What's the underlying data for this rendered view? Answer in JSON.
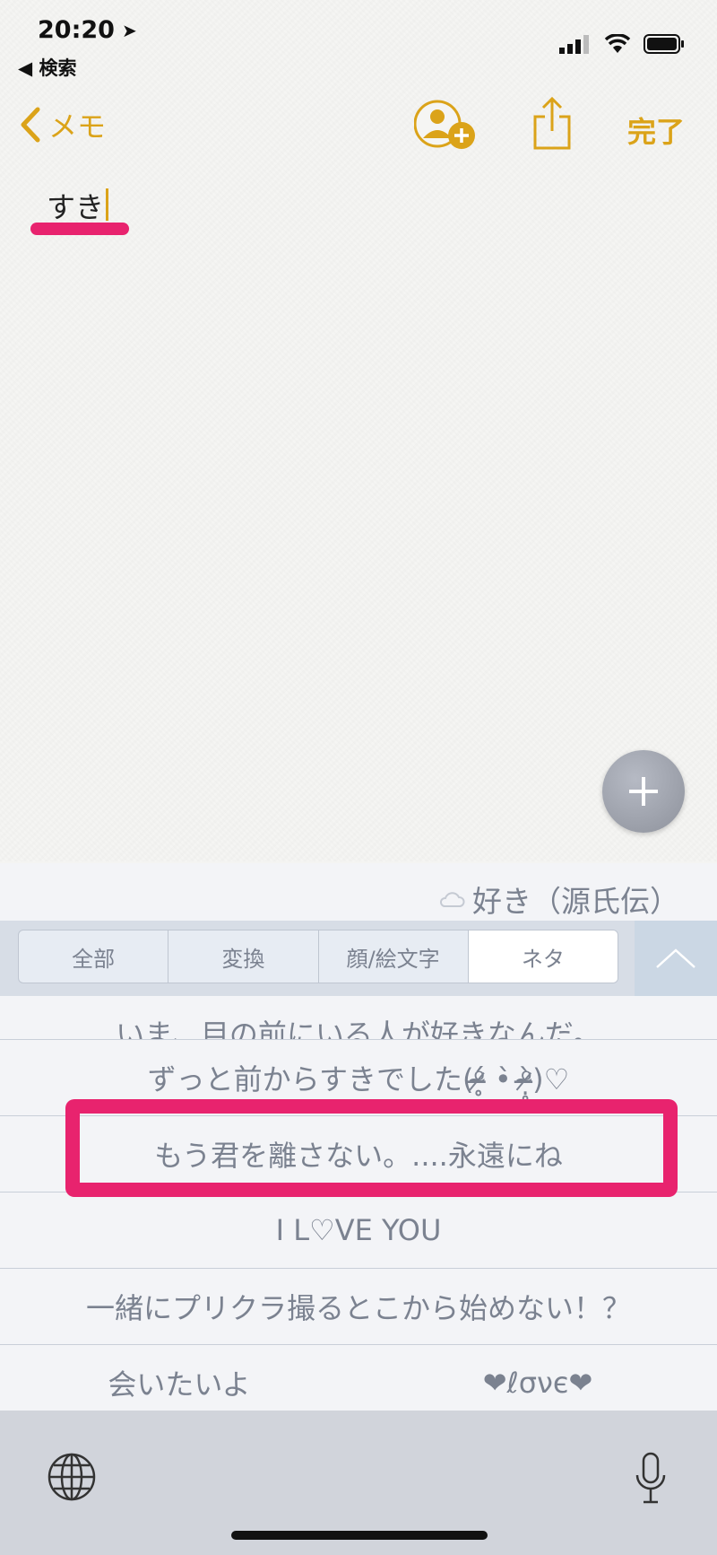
{
  "status": {
    "time": "20:20",
    "back_app": "◀ 検索"
  },
  "nav": {
    "back_label": "メモ",
    "done_label": "完了"
  },
  "note": {
    "text": "すき"
  },
  "keyboard": {
    "top_candidate": "好き（源氏伝）",
    "segments": [
      {
        "label": "全部",
        "active": false
      },
      {
        "label": "変換",
        "active": false
      },
      {
        "label": "顔/絵文字",
        "active": false
      },
      {
        "label": "ネタ",
        "active": true
      }
    ],
    "candidates": [
      "いま、目の前にいる人が好きなんだ。",
      "ずっと前からすきでした(ᵒ̴̶̷̥́ •̀ ᵒ̴̶̷̣̥̀)♡",
      "もう君を離さない。....永遠にね",
      "I L♡VE YOU",
      "一緒にプリクラ撮るとこから始めない！？"
    ],
    "last_row": [
      "会いたいよ",
      "❤ℓσνє❤"
    ]
  },
  "colors": {
    "accent": "#dba319",
    "highlight": "#e8236e",
    "candidate_text": "#7b8290"
  }
}
